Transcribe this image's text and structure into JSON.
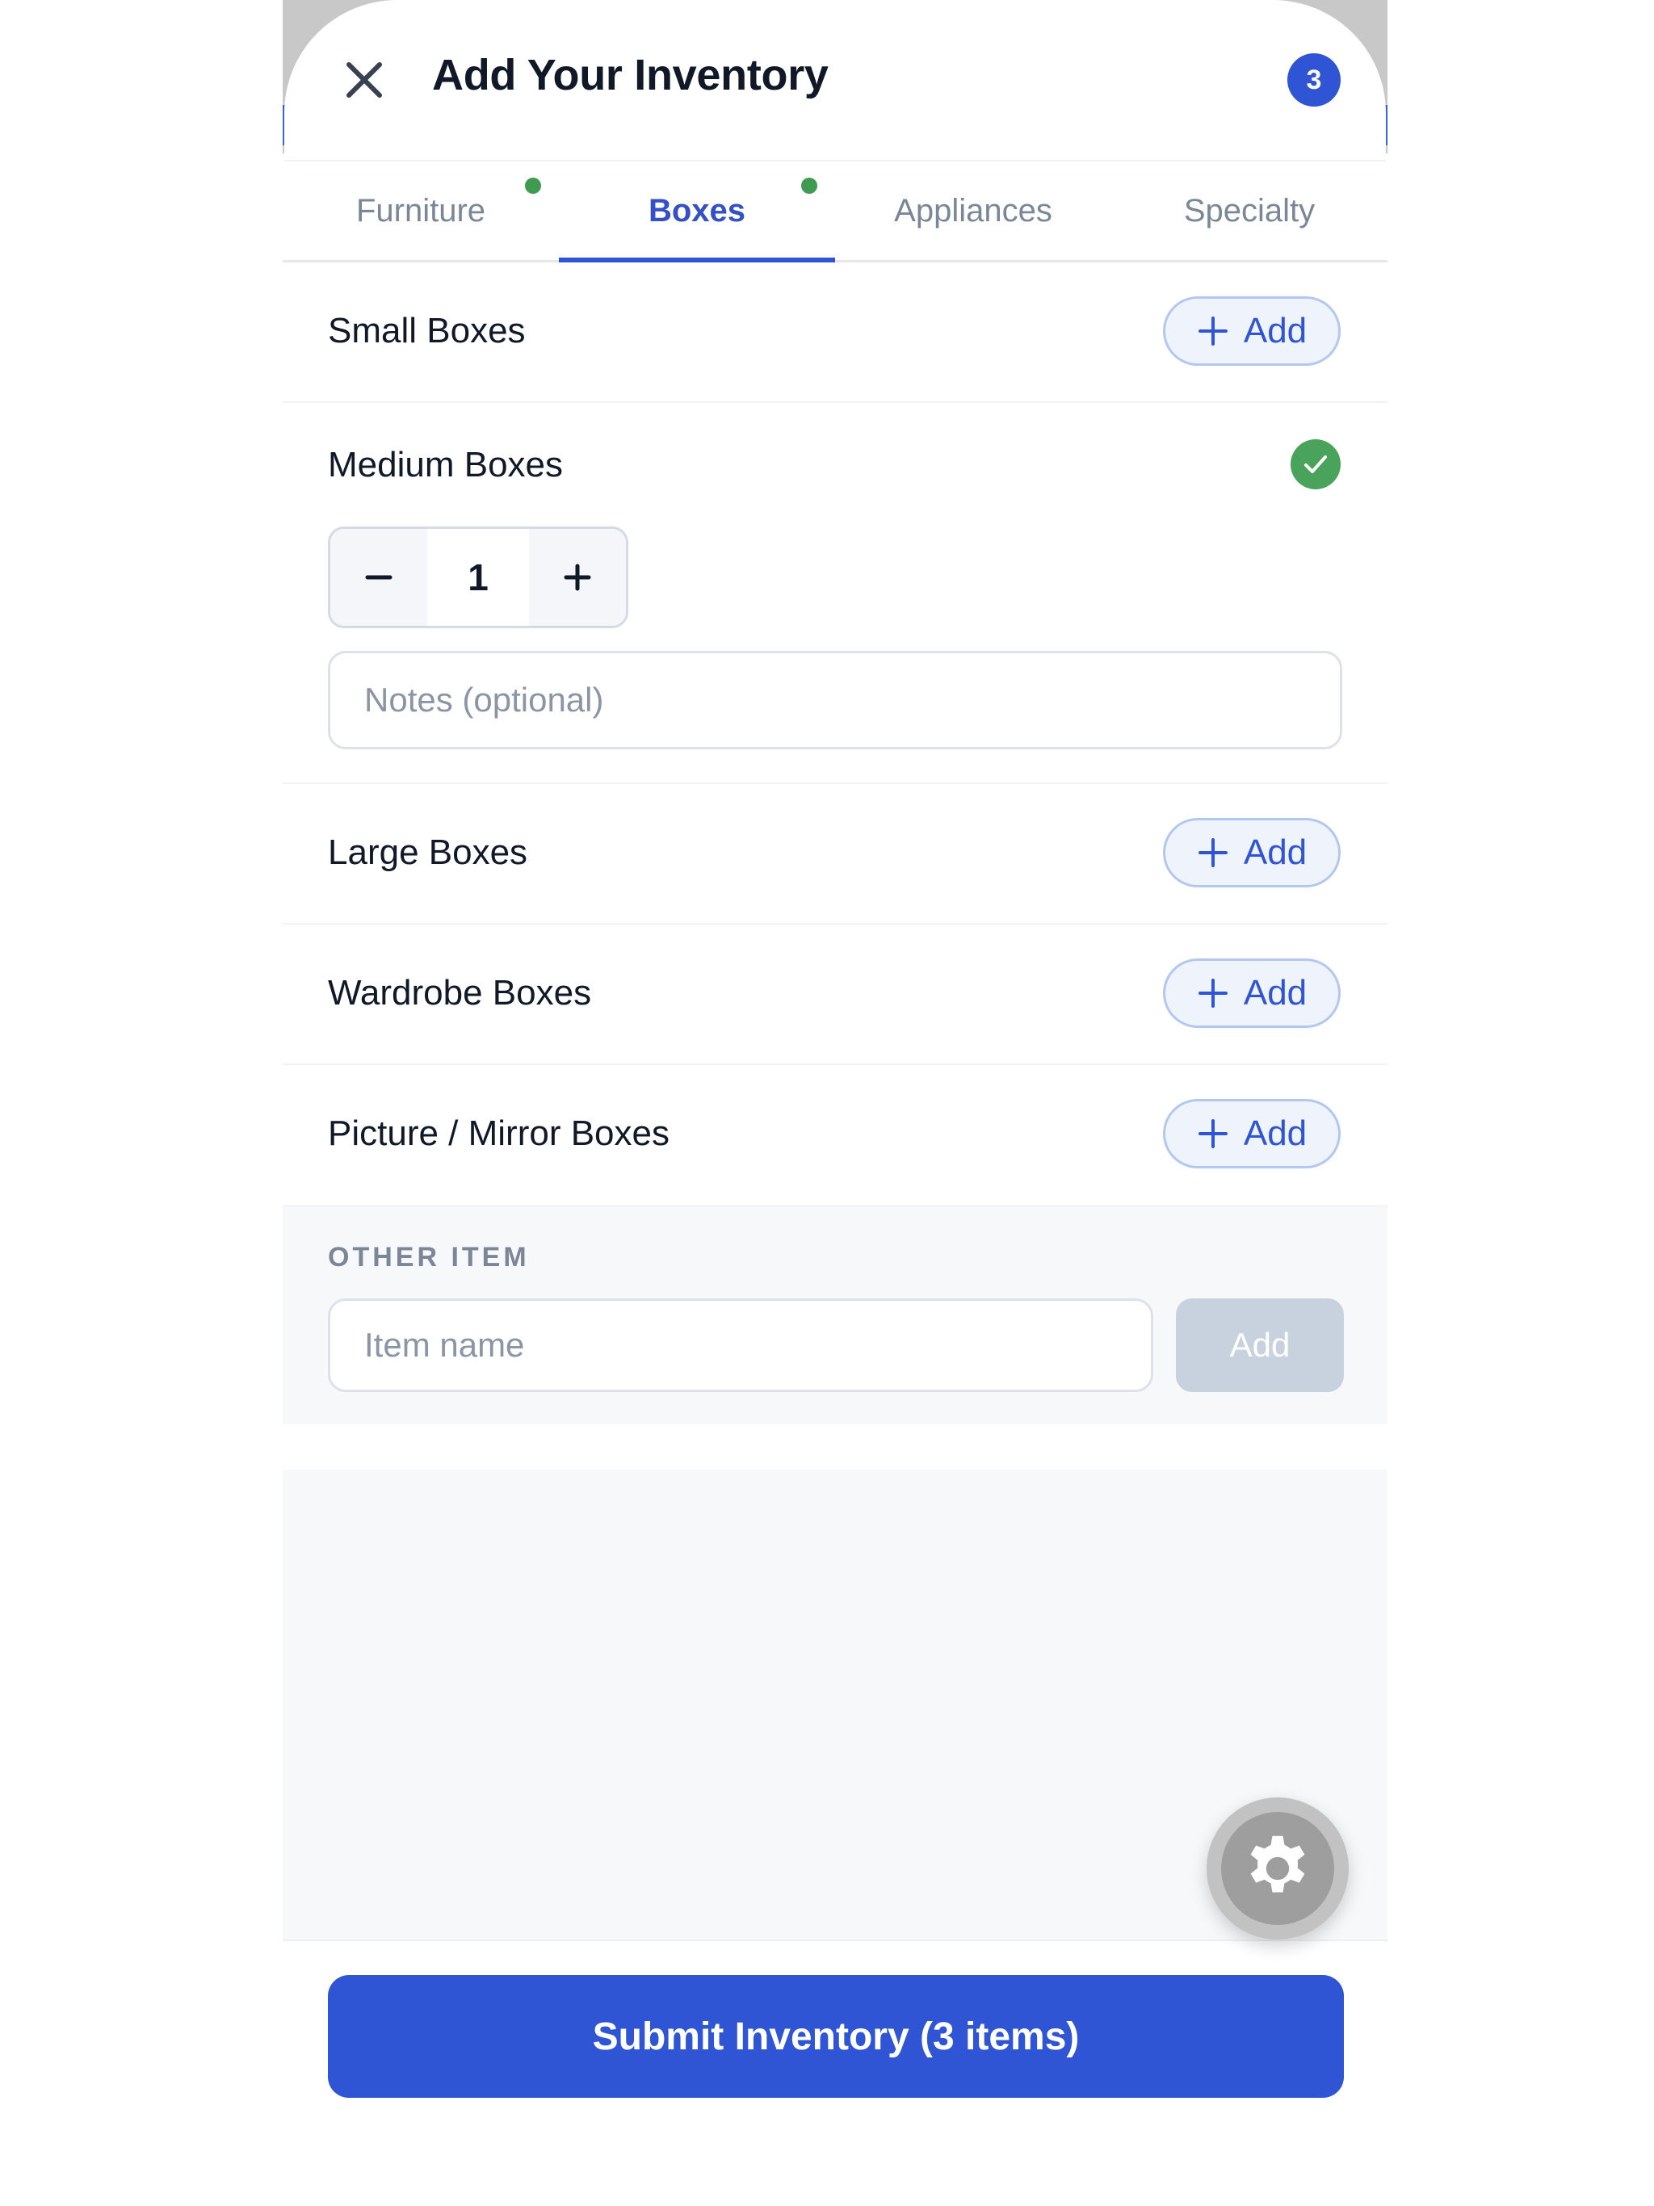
{
  "header": {
    "title": "Add Your Inventory",
    "item_count": "3"
  },
  "tabs": [
    {
      "label": "Furniture",
      "has_items": true,
      "active": false
    },
    {
      "label": "Boxes",
      "has_items": true,
      "active": true
    },
    {
      "label": "Appliances",
      "has_items": false,
      "active": false
    },
    {
      "label": "Specialty",
      "has_items": false,
      "active": false
    }
  ],
  "items": [
    {
      "name": "Small Boxes",
      "action_label": "Add"
    },
    {
      "name": "Medium Boxes",
      "selected": true,
      "quantity": "1",
      "notes_placeholder": "Notes (optional)"
    },
    {
      "name": "Large Boxes",
      "action_label": "Add"
    },
    {
      "name": "Wardrobe Boxes",
      "action_label": "Add"
    },
    {
      "name": "Picture / Mirror Boxes",
      "action_label": "Add"
    }
  ],
  "other_item": {
    "section_label": "OTHER ITEM",
    "input_placeholder": "Item name",
    "add_label": "Add"
  },
  "submit": {
    "label": "Submit Inventory (3 items)"
  },
  "icons": {
    "close": "close-icon",
    "check": "check-circle-icon",
    "plus": "plus-icon",
    "minus": "minus-icon",
    "settings": "gear-icon"
  },
  "colors": {
    "accent": "#2f55d4",
    "success": "#3f9b52",
    "disabled": "#c8d2df"
  }
}
